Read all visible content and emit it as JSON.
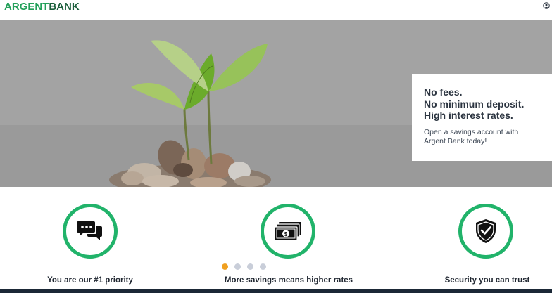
{
  "header": {
    "logo_part1": "ARGENT",
    "logo_part2": "BANK",
    "brand_color": "#23a05a",
    "brand_dark_color": "#1c5f3c"
  },
  "hero": {
    "headline_lines": [
      "No fees.",
      "No minimum deposit.",
      "High interest rates."
    ],
    "subtext": "Open a savings account with Argent Bank today!"
  },
  "features": [
    {
      "icon": "chat-icon",
      "label": "You are our #1 priority"
    },
    {
      "icon": "money-icon",
      "label": "More savings means higher rates"
    },
    {
      "icon": "shield-check-icon",
      "label": "Security you can trust"
    }
  ],
  "carousel": {
    "slides": 4,
    "active_index": 0,
    "active_color": "#f0a020"
  },
  "accent_green": "#21b36a"
}
